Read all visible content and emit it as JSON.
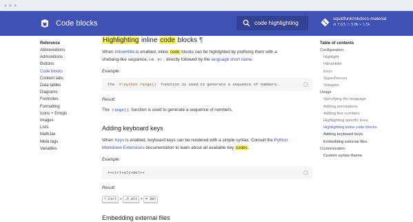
{
  "header": {
    "site_title": "Code blocks",
    "search_value": "code highlighting",
    "repo_name": "squidfunk/mkdocs-material",
    "repo_stats": "⊘ 7.0.5 ☆ 5.8k ⑂ 1.5k"
  },
  "nav": {
    "title": "Reference",
    "items": [
      {
        "label": "Abbreviations"
      },
      {
        "label": "Admonitions"
      },
      {
        "label": "Buttons"
      },
      {
        "label": "Code blocks",
        "active": true
      },
      {
        "label": "Content tabs"
      },
      {
        "label": "Data tables"
      },
      {
        "label": "Diagrams"
      },
      {
        "label": "Footnotes"
      },
      {
        "label": "Formatting"
      },
      {
        "label": "Icons + Emojis"
      },
      {
        "label": "Images"
      },
      {
        "label": "Lists"
      },
      {
        "label": "MathJax"
      },
      {
        "label": "Meta tags"
      },
      {
        "label": "Variables"
      }
    ]
  },
  "content": {
    "heading": {
      "pre": "Highlighting",
      "mid": " inline ",
      "code": "code",
      "post": " blocks",
      "pilcrow": "¶"
    },
    "intro_line1_a": "When ",
    "intro_link1": "InlineHilite",
    "intro_line1_b": " is enabled, inline ",
    "intro_code_hl": "code",
    "intro_line1_c": " blocks can be highlighted by prefixing them with a",
    "intro_line2_a": "shebang-like sequence, i.e. ",
    "intro_shebang": "#!",
    "intro_line2_b": ", directly followed by the ",
    "intro_link2": "language short name",
    "intro_line2_c": ".",
    "example_label": "Example:",
    "example_code_a": "The ",
    "example_code_str": "`#!python range()`",
    "example_code_b": " function is used to generate a sequence of numbers.",
    "result_label": "Result:",
    "result_a": "The ",
    "result_code": "range()",
    "result_b": " function is used to generate a sequence of numbers.",
    "keys_heading": "Adding keyboard keys",
    "keys_line1_a": "When ",
    "keys_link1": "Keys",
    "keys_line1_b": " is enabled, keyboard keys can be rendered with a simple syntax. Consult the ",
    "keys_link2a": "Python",
    "keys_line2_link": "Markdown Extensions",
    "keys_line2_a": " documentation to learn about all available key ",
    "keys_hl": "codes",
    "keys_line2_b": ".",
    "keys_example_label": "Example:",
    "keys_example_code": "++ctrl+alt+del++",
    "keys_result_label": "Result:",
    "keys": [
      "^ Ctrl",
      "⎇ Alt",
      "⌦ Del"
    ],
    "keys_sep": "+",
    "embed_heading": "Embedding external files"
  },
  "toc": {
    "title": "Table of contents",
    "items": [
      {
        "label": "Configuration",
        "level": 0
      },
      {
        "label": "Highlight",
        "level": 1
      },
      {
        "label": "InlineHilite",
        "level": 1
      },
      {
        "label": "Keys",
        "level": 1
      },
      {
        "label": "SuperFences",
        "level": 1
      },
      {
        "label": "Snippets",
        "level": 1
      },
      {
        "label": "Usage",
        "level": 0
      },
      {
        "label": "Specifying the language",
        "level": 1
      },
      {
        "label": "Adding annotations",
        "level": 1
      },
      {
        "label": "Adding line numbers",
        "level": 1
      },
      {
        "label": "Highlighting specific lines",
        "level": 1
      },
      {
        "label": "Highlighting inline code blocks",
        "level": 1,
        "active": true
      },
      {
        "label": "Adding keyboard keys",
        "level": 1,
        "dark": true
      },
      {
        "label": "Embedding external files",
        "level": 1,
        "dark": true
      },
      {
        "label": "Customization",
        "level": 0
      },
      {
        "label": "Custom syntax theme",
        "level": 1,
        "dark": true
      }
    ]
  },
  "colors": {
    "primary": "#4051b5",
    "highlight": "#fcf25f"
  }
}
